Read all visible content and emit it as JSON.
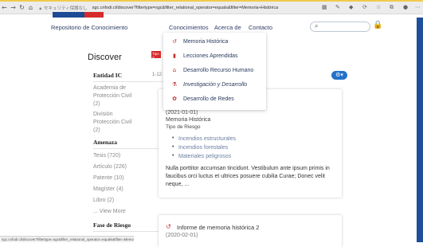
{
  "browser": {
    "back_icon": "back-arrow-icon",
    "forward_icon": "forward-arrow-icon",
    "reload_icon": "reload-icon",
    "home_icon": "home-icon",
    "secure_label": "▲ セキュリティ保護なし",
    "url": "sgc.cnfodi.cl/discover?filtertype=sgc&filter_relational_operator=equals&filter=Memoria+Histórica",
    "status_url": "sgc.cnfodi.cl/discover?filtertype=sgc&filter_relational_operator=equals&filter=Memoria+Histórica"
  },
  "header": {
    "brand_colors": [
      "#1d4a94",
      "#d62b2b"
    ],
    "nav": {
      "repositorio": "Repositorio de Conocimiento",
      "conocimientos": "Conocimientos",
      "acerca": "Acerca de",
      "contacto": "Contacto"
    },
    "search_placeholder": "Q",
    "lock_icon": "lock-icon"
  },
  "dropdown": {
    "items": [
      {
        "label": "Memoria Histórica",
        "icon": "history-icon"
      },
      {
        "label": "Lecciones Aprendidas",
        "icon": "book-icon"
      },
      {
        "label": "Desarrollo Recurso Humano",
        "icon": "institution-icon"
      },
      {
        "label": "Investigación y Desarrollo",
        "icon": "microscope-icon"
      },
      {
        "label": "Desarrollo de Redes",
        "icon": "network-icon"
      }
    ]
  },
  "sidebar": {
    "title": "Discover",
    "sections": [
      {
        "heading": "Entidad IC",
        "items": [
          "Academia de",
          "Protección Civil",
          "(2)",
          "División",
          "Protección Civil",
          "(2)"
        ]
      },
      {
        "heading": "Amenaza",
        "items": [
          "Tesis (720)",
          "Artículo (226)",
          "Patente (10)",
          "Magíster (4)",
          "Libro (2)",
          "... View More"
        ]
      },
      {
        "heading": "Fase de Riesgo",
        "items": []
      }
    ]
  },
  "main": {
    "filter_tag": "Tipo d",
    "results_prefix": "1-12 /",
    "gear_icon": "gear-icon",
    "card1": {
      "date": "(2021-01-01)",
      "type": "Memoria Histórica",
      "riesgo": "Tipo de Riesgo",
      "bullets": [
        "Incendios estructurales",
        "Incendios forestales",
        "Materiales peligrosos"
      ],
      "body": "Nulla porttitor accumsan tincidunt. Vestibulum ante ipsum primis in faucibus orci luctus et ultrices posuere cubilia Curae; Donec velit neque, ..."
    },
    "card2": {
      "title": "Informe de memoria histórica 2",
      "date": "(2020-02-01)"
    }
  }
}
